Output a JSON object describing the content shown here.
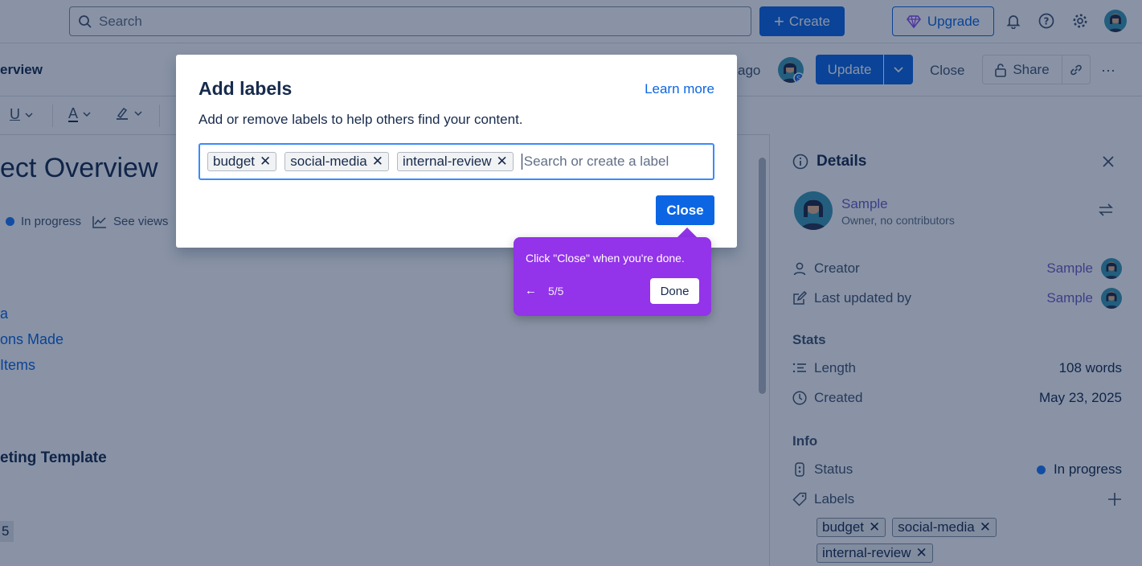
{
  "topbar": {
    "search_placeholder": "Search",
    "create_label": "Create",
    "upgrade_label": "Upgrade"
  },
  "pagebar": {
    "breadcrumb": "erview",
    "edited_ago": "ago",
    "update_label": "Update",
    "close_label": "Close",
    "share_label": "Share",
    "more": "⋯"
  },
  "toolbar": {
    "underline": "U",
    "text_color": "A"
  },
  "content": {
    "title": "ect Overview",
    "status": "In progress",
    "see_views": "See views",
    "toc": [
      "a",
      "ons Made",
      "Items"
    ],
    "heading": "eting Template",
    "chip": "5"
  },
  "modal": {
    "title": "Add labels",
    "learn_more": "Learn more",
    "description": "Add or remove labels to help others find your content.",
    "labels": [
      "budget",
      "social-media",
      "internal-review"
    ],
    "input_placeholder": "Search or create a label",
    "close_label": "Close"
  },
  "tooltip": {
    "text": "Click \"Close\" when you're done.",
    "step": "5/5",
    "done_label": "Done"
  },
  "details": {
    "title": "Details",
    "owner_name": "Sample",
    "owner_sub": "Owner, no contributors",
    "creator_label": "Creator",
    "creator_value": "Sample",
    "last_updated_label": "Last updated by",
    "last_updated_value": "Sample",
    "stats_heading": "Stats",
    "length_label": "Length",
    "length_value": "108 words",
    "created_label": "Created",
    "created_value": "May 23, 2025",
    "info_heading": "Info",
    "status_label": "Status",
    "status_value": "In progress",
    "labels_label": "Labels",
    "labels": [
      "budget",
      "social-media",
      "internal-review"
    ]
  },
  "colors": {
    "primary": "#0c66e4",
    "tooltip": "#9333ea",
    "status_dot": "#1d7afc",
    "owner_link": "#6e5dc6"
  }
}
